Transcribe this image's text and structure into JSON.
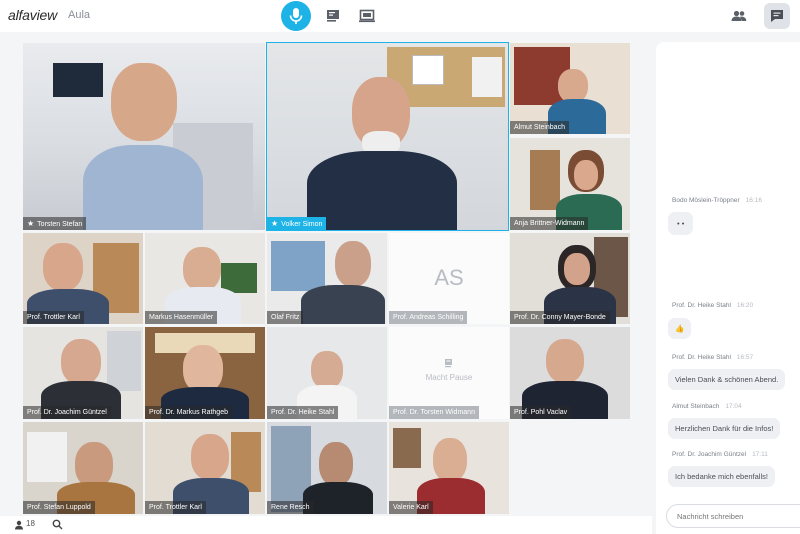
{
  "app": {
    "logo": "alfaview",
    "room": "Aula"
  },
  "toolbar": {
    "icons": [
      "microphone-icon",
      "presentation-icon",
      "screen-share-icon",
      "participants-icon",
      "chat-icon"
    ],
    "accent": "#1eb3e6"
  },
  "tiles": [
    {
      "name": "Torsten Stefan",
      "star": "★"
    },
    {
      "name": "Volker Simon",
      "star": "★"
    },
    {
      "name": "Almut Steinbach"
    },
    {
      "name": "Anja Brittner-Widmann"
    },
    {
      "name": "Prof. Trottler Karl"
    },
    {
      "name": "Markus Hasenmüller"
    },
    {
      "name": "Olaf Fritz"
    },
    {
      "name": "Prof. Andreas Schilling",
      "initials": "AS"
    },
    {
      "name": "Prof. Dr. Conny Mayer-Bonde"
    },
    {
      "name": "Prof. Dr. Joachim Güntzel"
    },
    {
      "name": "Prof. Dr. Markus Rathgeb"
    },
    {
      "name": "Prof. Dr. Heike Stahl"
    },
    {
      "name": "Prof. Dr. Torsten Widmann",
      "status": "Macht Pause"
    },
    {
      "name": "Prof. Pohl Vaclav"
    },
    {
      "name": "Prof. Stefan Luppold"
    },
    {
      "name": "Prof. Trottler Karl"
    },
    {
      "name": "Rene Resch"
    },
    {
      "name": "Valerie Karl"
    }
  ],
  "bottombar": {
    "participant_count": "18"
  },
  "chat": {
    "messages": [
      {
        "author": "Bodo Möslein-Tröppner",
        "time": "16:16",
        "text": "• •"
      },
      {
        "author": "Prof. Dr. Heike Stahl",
        "time": "16:20",
        "text": "👍"
      },
      {
        "author": "Prof. Dr. Heike Stahl",
        "time": "16:57",
        "text": "Vielen Dank & schönen Abend."
      },
      {
        "author": "Almut Steinbach",
        "time": "17:04",
        "text": "Herzlichen Dank für die Infos!"
      },
      {
        "author": "Prof. Dr. Joachim Güntzel",
        "time": "17:11",
        "text": "Ich bedanke mich ebenfalls!"
      }
    ],
    "input_placeholder": "Nachricht schreiben"
  }
}
